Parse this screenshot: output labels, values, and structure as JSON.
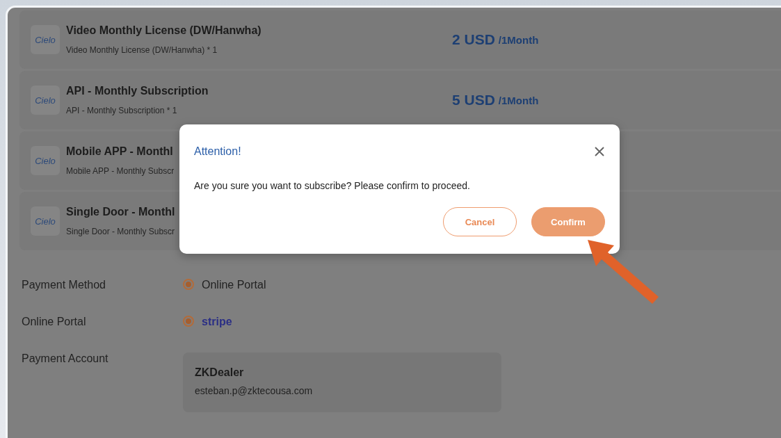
{
  "products": [
    {
      "title": "Video Monthly License (DW/Hanwha)",
      "detail": "Video Monthly License (DW/Hanwha) * 1",
      "logo": "Cielo",
      "price": "2 USD",
      "period": "/1Month"
    },
    {
      "title": "API - Monthly Subscription",
      "detail": "API - Monthly Subscription * 1",
      "logo": "Cielo",
      "price": "5 USD",
      "period": "/1Month"
    },
    {
      "title": "Mobile APP - Monthl",
      "detail": "Mobile APP - Monthly Subscr",
      "logo": "Cielo"
    },
    {
      "title": "Single Door - Monthl",
      "detail": "Single Door - Monthly Subscr",
      "logo": "Cielo"
    }
  ],
  "payment_method": {
    "label": "Payment Method",
    "options": [
      {
        "label": "Online Portal",
        "selected": true
      }
    ]
  },
  "online_portal": {
    "label": "Online Portal",
    "options": [
      {
        "label": "stripe",
        "selected": true
      }
    ]
  },
  "payment_account": {
    "label": "Payment Account",
    "name": "ZKDealer",
    "email": "esteban.p@zktecousa.com"
  },
  "dialog": {
    "title": "Attention!",
    "message": "Are you sure you want to subscribe? Please confirm to proceed.",
    "buttons": [
      {
        "label": "Cancel",
        "kind": "outline"
      },
      {
        "label": "Confirm",
        "kind": "filled"
      }
    ]
  }
}
